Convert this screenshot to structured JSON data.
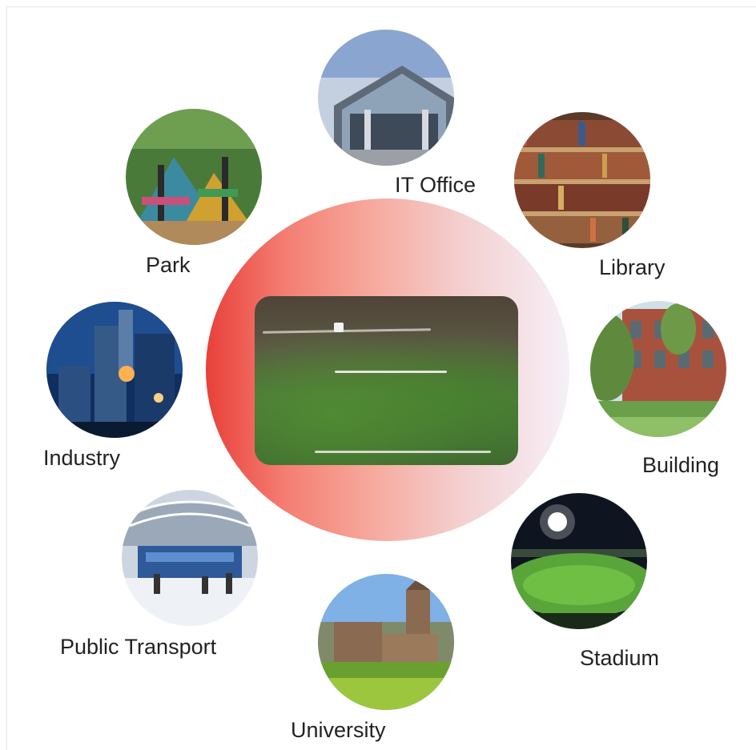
{
  "center": {
    "image": "grass-field-photo"
  },
  "nodes": [
    {
      "label": "IT Office",
      "image": "office-building-photo"
    },
    {
      "label": "Library",
      "image": "bookshelf-photo"
    },
    {
      "label": "Building",
      "image": "brick-building-photo"
    },
    {
      "label": "Stadium",
      "image": "night-stadium-photo"
    },
    {
      "label": "University",
      "image": "university-tower-photo"
    },
    {
      "label": "Public Transport",
      "image": "station-hall-photo"
    },
    {
      "label": "Industry",
      "image": "industrial-plant-photo"
    },
    {
      "label": "Park",
      "image": "playground-photo"
    }
  ]
}
